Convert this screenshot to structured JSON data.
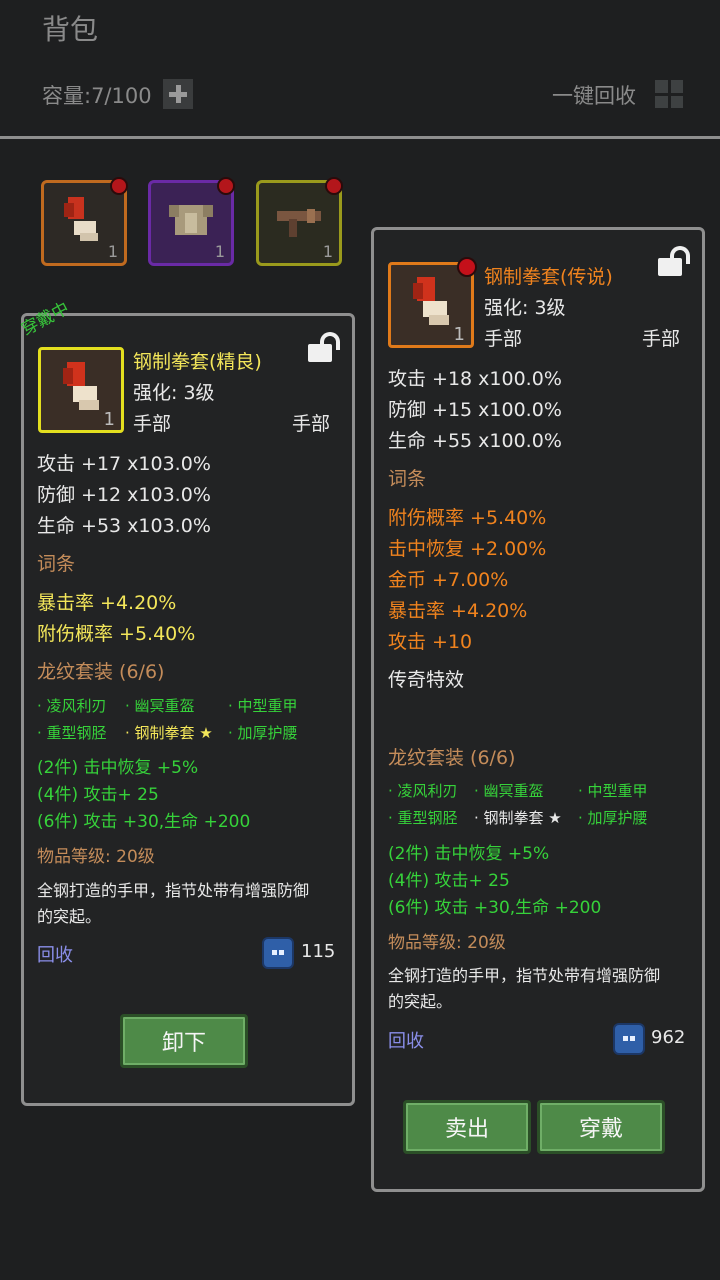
{
  "header": {
    "title": "背包",
    "capacity": "容量:7/100",
    "recycle_all": "一键回收"
  },
  "inventory": [
    {
      "count": "1",
      "rarity": "orange"
    },
    {
      "count": "1",
      "rarity": "purple"
    },
    {
      "count": "1",
      "rarity": "yellow"
    }
  ],
  "left": {
    "equipped_tag": "穿戴中",
    "name": "钢制拳套(精良)",
    "enhance": "强化:  3级",
    "slot_label": "手部",
    "slot_value": "手部",
    "count": "1",
    "stats": [
      "攻击 +17  x103.0%",
      "防御 +12  x103.0%",
      "生命 +53  x103.0%"
    ],
    "affix_title": "词条",
    "affixes": [
      "暴击率 +4.20%",
      "附伤概率 +5.40%"
    ],
    "set_title": "龙纹套装 (6/6)",
    "set_items": [
      "· 凌风利刃",
      "· 幽冥重盔",
      "· 中型重甲",
      "· 重型钢胫",
      "· 钢制拳套 ★",
      "· 加厚护腰"
    ],
    "set_bonus": [
      "(2件) 击中恢复 +5%",
      "(4件) 攻击+ 25",
      "(6件) 攻击 +30,生命 +200"
    ],
    "item_level": "物品等级:  20级",
    "desc_1": "全钢打造的手甲，指节处带有增强防御",
    "desc_2": "的突起。",
    "recycle": "回收",
    "price": "115",
    "unequip": "卸下"
  },
  "right": {
    "name": "钢制拳套(传说)",
    "enhance": "强化:  3级",
    "slot_label": "手部",
    "slot_value": "手部",
    "count": "1",
    "stats": [
      "攻击 +18  x100.0%",
      "防御 +15  x100.0%",
      "生命 +55  x100.0%"
    ],
    "affix_title": "词条",
    "affixes": [
      "附伤概率 +5.40%",
      "击中恢复 +2.00%",
      "金币 +7.00%",
      "暴击率 +4.20%",
      "攻击 +10"
    ],
    "legend_title": "传奇特效",
    "set_title": "龙纹套装 (6/6)",
    "set_items": [
      "· 凌风利刃",
      "· 幽冥重盔",
      "· 中型重甲",
      "· 重型钢胫",
      "· 钢制拳套 ★",
      "· 加厚护腰"
    ],
    "set_bonus": [
      "(2件) 击中恢复 +5%",
      "(4件) 攻击+ 25",
      "(6件) 攻击 +30,生命 +200"
    ],
    "item_level": "物品等级:  20级",
    "desc_1": "全钢打造的手甲，指节处带有增强防御",
    "desc_2": "的突起。",
    "recycle": "回收",
    "price": "962",
    "sell": "卖出",
    "equip": "穿戴"
  }
}
